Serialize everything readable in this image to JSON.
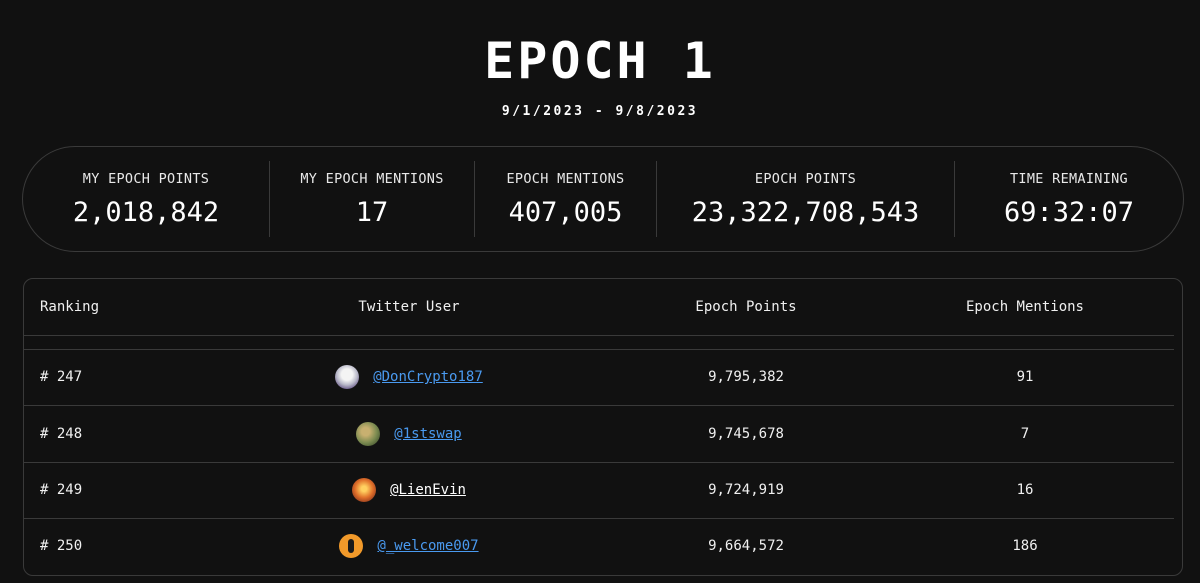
{
  "header": {
    "title": "EPOCH 1",
    "date_range": "9/1/2023 - 9/8/2023"
  },
  "stats": [
    {
      "label": "MY EPOCH POINTS",
      "value": "2,018,842"
    },
    {
      "label": "MY EPOCH MENTIONS",
      "value": "17"
    },
    {
      "label": "EPOCH MENTIONS",
      "value": "407,005"
    },
    {
      "label": "EPOCH POINTS",
      "value": "23,322,708,543"
    },
    {
      "label": "TIME REMAINING",
      "value": "69:32:07"
    }
  ],
  "table": {
    "columns": [
      "Ranking",
      "Twitter User",
      "Epoch Points",
      "Epoch Mentions"
    ],
    "rows": [
      {
        "rank": "# 247",
        "user": "@DonCrypto187",
        "points": "9,795,382",
        "mentions": "91"
      },
      {
        "rank": "# 248",
        "user": "@1stswap",
        "points": "9,745,678",
        "mentions": "7"
      },
      {
        "rank": "# 249",
        "user": "@LienEvin",
        "points": "9,724,919",
        "mentions": "16"
      },
      {
        "rank": "# 250",
        "user": "@_welcome007",
        "points": "9,664,572",
        "mentions": "186"
      }
    ]
  },
  "colors": {
    "background": "#111111",
    "border": "#3a3a3a",
    "link": "#4a9af0"
  }
}
